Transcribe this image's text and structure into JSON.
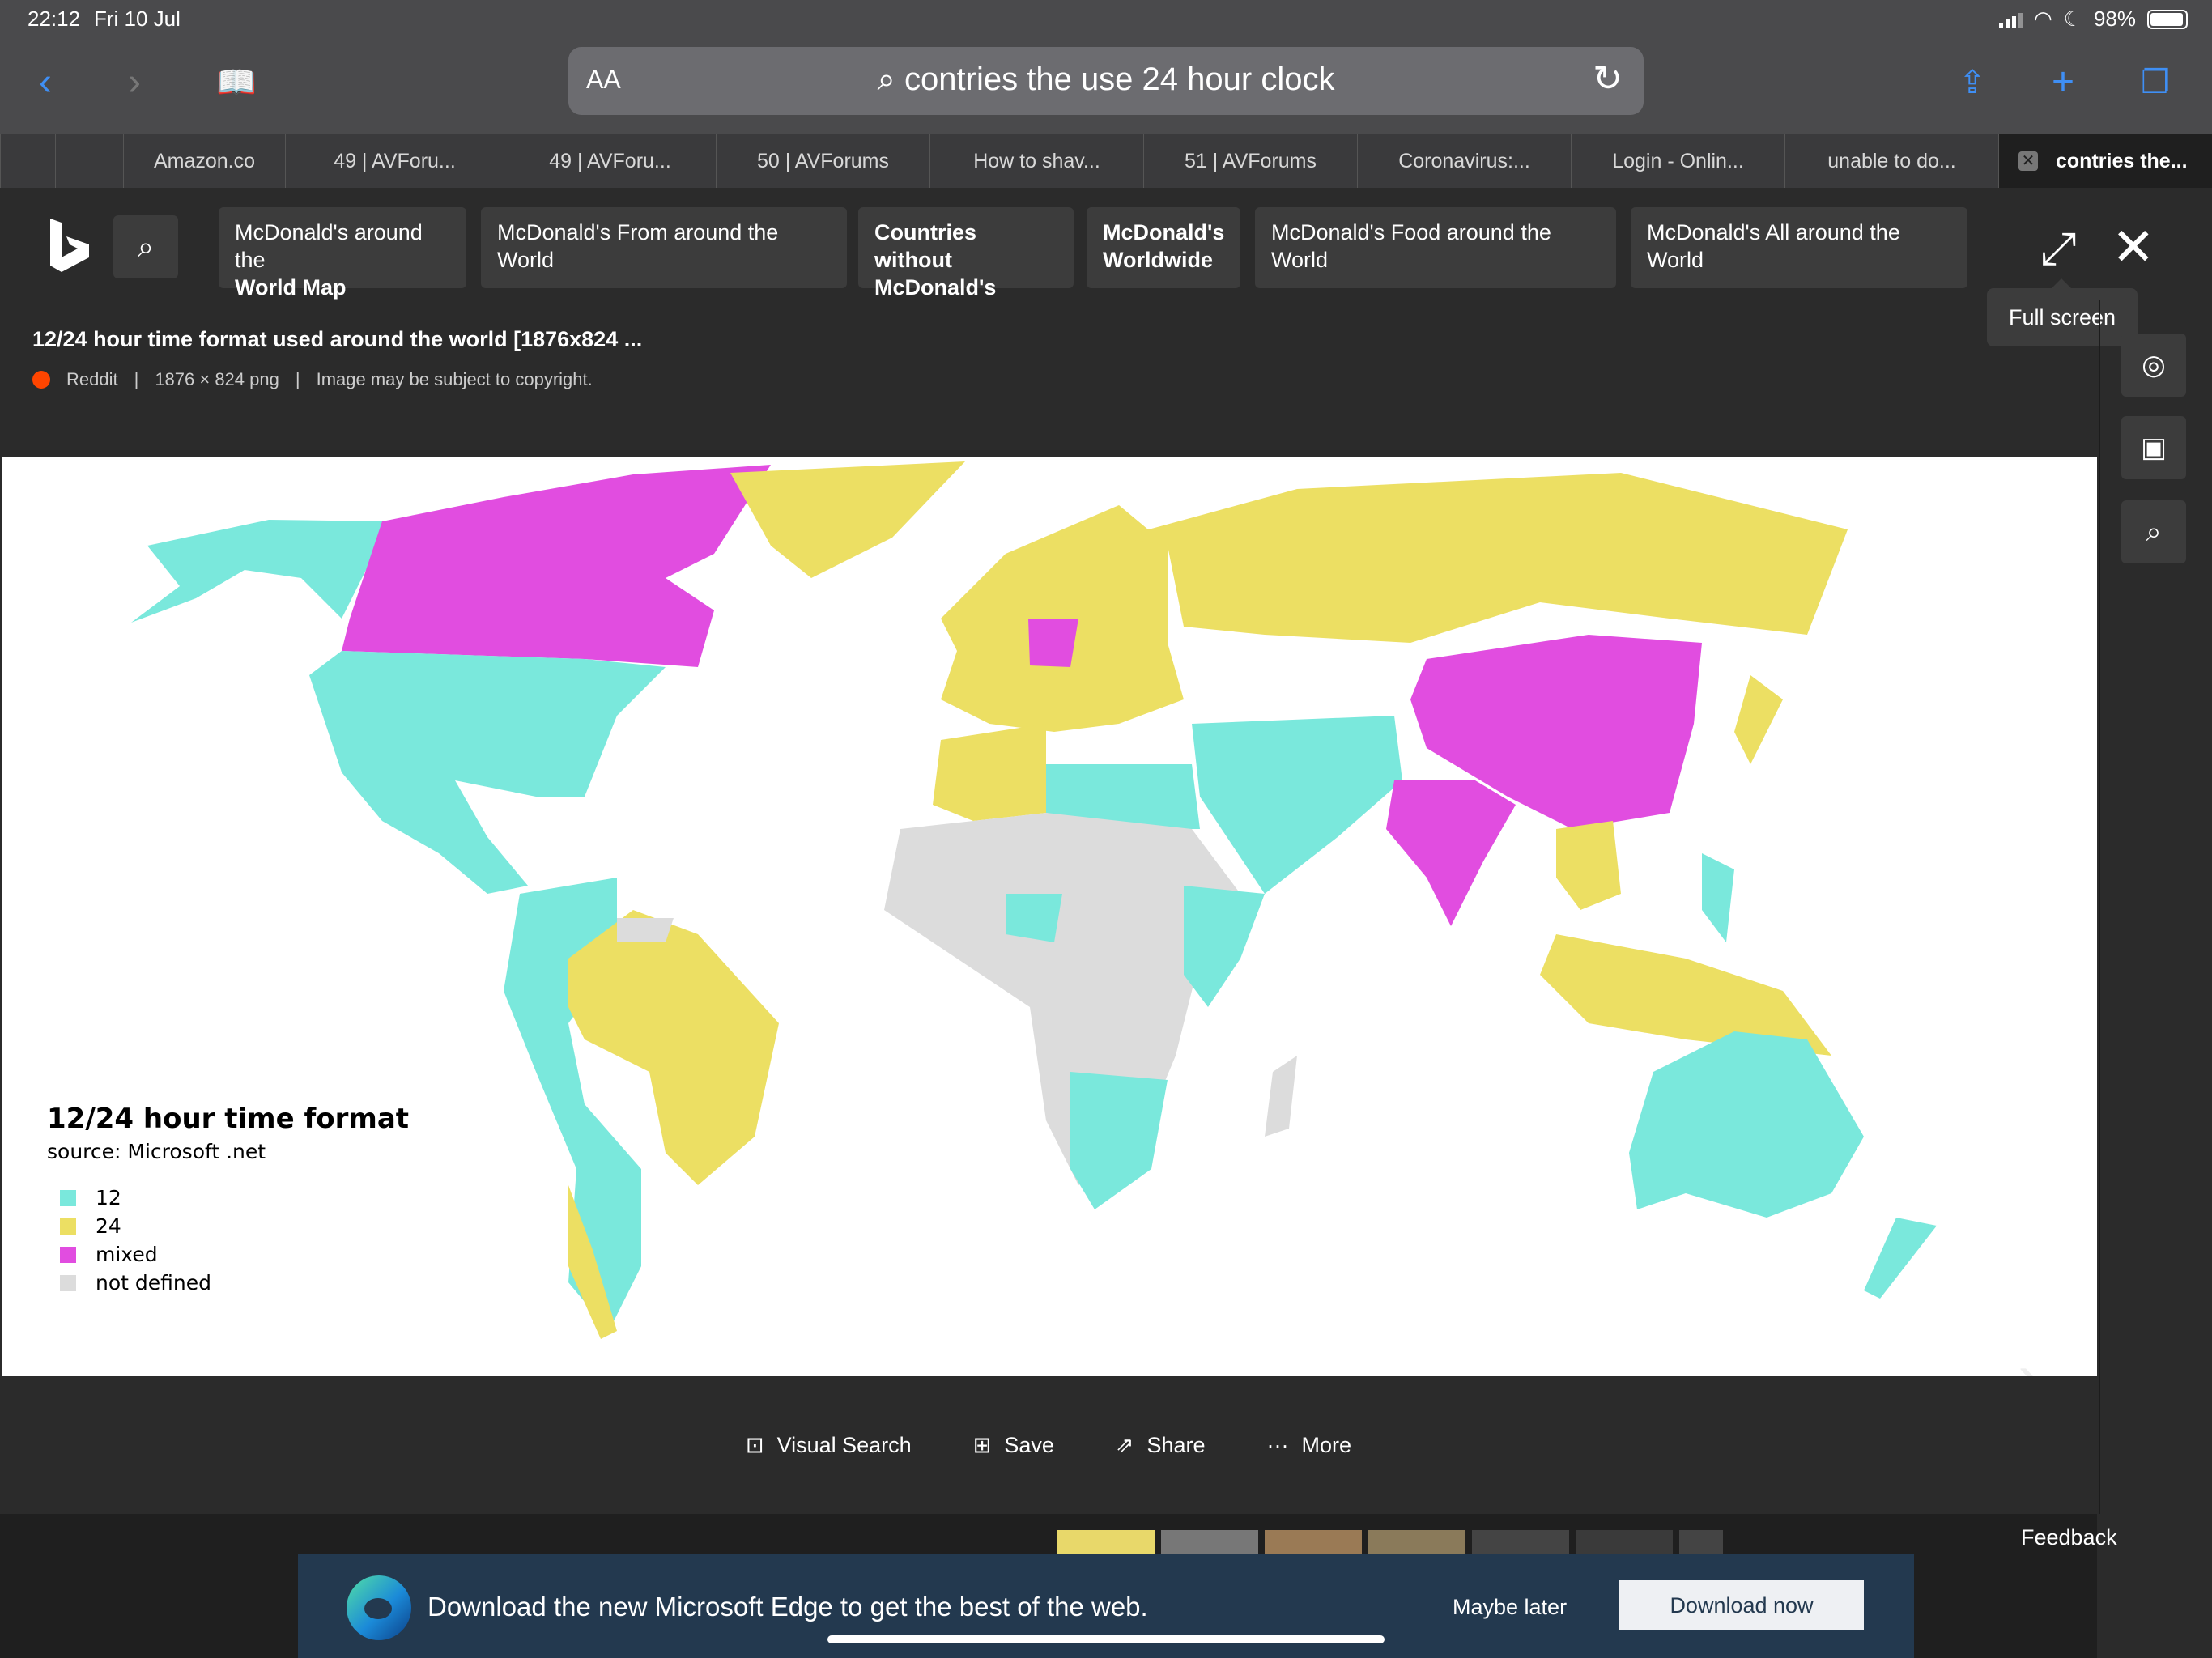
{
  "status": {
    "time": "22:12",
    "date": "Fri 10 Jul",
    "battery": "98%"
  },
  "toolbar": {
    "aa": "AA",
    "query": "contries the use 24 hour clock"
  },
  "tabs": [
    {
      "label": ""
    },
    {
      "label": "Amazon.co"
    },
    {
      "label": "49 | AVForu..."
    },
    {
      "label": "49 | AVForu..."
    },
    {
      "label": "50 | AVForums"
    },
    {
      "label": "How to shav..."
    },
    {
      "label": "51 | AVForums"
    },
    {
      "label": "Coronavirus:..."
    },
    {
      "label": "Login - Onlin..."
    },
    {
      "label": "unable to do..."
    },
    {
      "label": "contries the..."
    }
  ],
  "related": [
    {
      "line1": "McDonald's around the",
      "line2": "World Map"
    },
    {
      "line1": "McDonald's From around the World",
      "line2": ""
    },
    {
      "line1": "Countries without",
      "line2": "McDonald's"
    },
    {
      "line1": "McDonald's",
      "line2": "Worldwide"
    },
    {
      "line1": "McDonald's Food around the World",
      "line2": ""
    },
    {
      "line1": "McDonald's All around the World",
      "line2": ""
    }
  ],
  "tooltip": "Full screen",
  "image": {
    "title": "12/24 hour time format used around the world [1876x824 ...",
    "source": "Reddit",
    "size": "1876 × 824 png",
    "copyright": "Image may be subject to copyright."
  },
  "map": {
    "title": "12/24 hour time format",
    "source": "source: Microsoft .net",
    "legend": [
      {
        "label": "12",
        "color": "#7ae8dc"
      },
      {
        "label": "24",
        "color": "#ecdf63"
      },
      {
        "label": "mixed",
        "color": "#e14de0"
      },
      {
        "label": "not defined",
        "color": "#dcdcdc"
      }
    ]
  },
  "actions": {
    "visual": "Visual Search",
    "save": "Save",
    "share": "Share",
    "more": "More"
  },
  "feedback": "Feedback",
  "banner": {
    "text": "Download the new Microsoft Edge to get the best of the web.",
    "maybe": "Maybe later",
    "download": "Download now"
  }
}
